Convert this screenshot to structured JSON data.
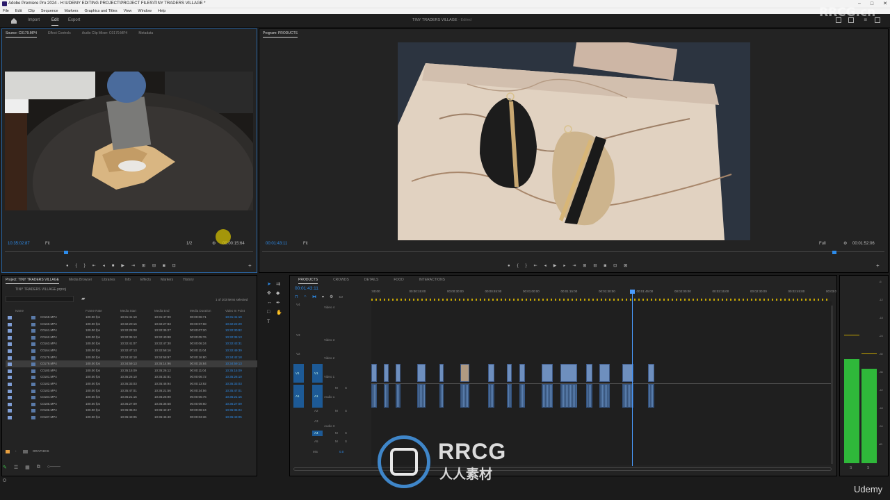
{
  "titlebar": {
    "title": "Adobe Premiere Pro 2024 - H:\\UDEMY EDITING PROJECT\\PROJECT FILES\\TINY TRADERS VILLAGE *"
  },
  "menubar": [
    "File",
    "Edit",
    "Clip",
    "Sequence",
    "Markers",
    "Graphics and Titles",
    "View",
    "Window",
    "Help"
  ],
  "header": {
    "workspaces": [
      "Import",
      "Edit",
      "Export"
    ],
    "project_title": "TINY TRADERS VILLAGE",
    "edited": "- Edited"
  },
  "source_panel": {
    "tabs": [
      "Source: C0179.MP4",
      "Effect Controls",
      "Audio Clip Mixer: C0179.MP4",
      "Metadata"
    ],
    "timecode": "10:35:02:87",
    "zoom": "Fit",
    "resolution": "1/2",
    "duration": "00:00:15:64"
  },
  "program_panel": {
    "tab": "Program: PRODUCTS",
    "timecode": "00:01:43:11",
    "zoom": "Fit",
    "resolution": "Full",
    "duration": "00:01:52:06"
  },
  "project_panel": {
    "tabs": [
      "Project: TINY TRADERS VILLAGE",
      "Media Browser",
      "Libraries",
      "Info",
      "Effects",
      "Markers",
      "History"
    ],
    "file": "TINY TRADERS VILLAGE.prproj",
    "selection": "1 of 103 items selected",
    "columns": [
      "Name",
      "Frame Rate",
      "Media Start",
      "Media End",
      "Media Duration",
      "Video In Point"
    ],
    "rows": [
      [
        "C0159.MP4",
        "100.00 fps",
        "10:31:41:19",
        "10:31:47:90",
        "00:00:06:71",
        "10:31:41:19"
      ],
      [
        "C0160.MP4",
        "100.00 fps",
        "10:32:20:16",
        "10:32:27:83",
        "00:00:07:68",
        "10:32:22:29"
      ],
      [
        "C0161.MP4",
        "100.00 fps",
        "10:32:28:08",
        "10:32:35:27",
        "00:00:07:20",
        "10:32:30:82"
      ],
      [
        "C0162.MP4",
        "100.00 fps",
        "10:32:35:13",
        "10:32:40:88",
        "00:00:05:76",
        "10:32:35:13"
      ],
      [
        "C0163.MP4",
        "100.00 fps",
        "10:32:41:07",
        "10:32:47:30",
        "00:00:06:24",
        "10:32:43:31"
      ],
      [
        "C0164.MP4",
        "100.00 fps",
        "10:32:47:13",
        "10:32:58:16",
        "00:00:11:04",
        "10:32:49:39"
      ],
      [
        "C0178.MP4",
        "100.00 fps",
        "10:34:42:18",
        "10:34:58:97",
        "00:00:16:80",
        "10:34:42:18"
      ],
      [
        "C0179.MP4",
        "100.00 fps",
        "10:34:59:13",
        "10:35:14:96",
        "00:00:15:84",
        "10:34:59:13"
      ],
      [
        "C0180.MP4",
        "100.00 fps",
        "10:35:15:09",
        "10:35:26:12",
        "00:00:11:04",
        "10:35:15:09"
      ],
      [
        "C0181.MP4",
        "100.00 fps",
        "10:35:26:10",
        "10:35:32:81",
        "00:00:06:72",
        "10:35:26:10"
      ],
      [
        "C0182.MP4",
        "100.00 fps",
        "10:35:33:03",
        "10:35:46:94",
        "00:00:13:92",
        "10:35:33:03"
      ],
      [
        "C0183.MP4",
        "100.00 fps",
        "10:35:47:01",
        "10:36:21:56",
        "00:00:34:56",
        "10:35:47:01"
      ],
      [
        "C0184.MP4",
        "100.00 fps",
        "10:36:21:15",
        "10:36:26:90",
        "00:00:05:76",
        "10:36:21:15"
      ],
      [
        "C0185.MP4",
        "100.00 fps",
        "10:36:27:09",
        "10:36:36:68",
        "00:00:09:60",
        "10:36:27:09"
      ],
      [
        "C0186.MP4",
        "100.00 fps",
        "10:36:36:24",
        "10:36:42:47",
        "00:00:06:24",
        "10:36:36:24"
      ],
      [
        "C0187.MP4",
        "100.00 fps",
        "10:36:43:05",
        "10:36:46:40",
        "00:00:03:36",
        "10:36:43:05"
      ]
    ],
    "folder": "GRAPHICS"
  },
  "timeline": {
    "tabs": [
      "PRODUCTS",
      "CROWDS",
      "DETAILS",
      "FOOD",
      "INTERACTIONS"
    ],
    "timecode": "00:01:43:11",
    "ruler": [
      ":00:00",
      "00:00:15:00",
      "00:00:30:00",
      "00:00:45:00",
      "00:01:00:00",
      "00:01:15:00",
      "00:01:30:00",
      "00:01:45:00",
      "00:02:00:00",
      "00:02:15:00",
      "00:02:30:00",
      "00:02:45:00",
      "00:03:0"
    ],
    "tracks": {
      "v4": "V4",
      "video4": "Video 4",
      "v3": "V3",
      "video3": "Video 3",
      "v2": "V2",
      "video2": "Video 2",
      "v1": "V1",
      "video1": "Video 1",
      "a1": "A1",
      "audio1": "Audio 1",
      "a2": "A2",
      "a3": "A3",
      "audio3": "Audio 3",
      "a4": "A4",
      "a5": "A5",
      "mix": "Mix",
      "mixval": "0.0"
    },
    "m": "M",
    "s": "S"
  },
  "meter": {
    "scale": [
      "-6",
      "-12",
      "-18",
      "-24",
      "-30",
      "-36",
      "-42",
      "-48",
      "-54",
      "dB"
    ],
    "s1": "S",
    "s2": "S"
  },
  "watermark": {
    "top": "RRCG.cn",
    "brand": "RRCG",
    "cn": "人人素材",
    "udemy": "Udemy"
  },
  "colors": {
    "accent": "#2d8ceb",
    "panel": "#232323",
    "meter": "#2fb83a"
  }
}
